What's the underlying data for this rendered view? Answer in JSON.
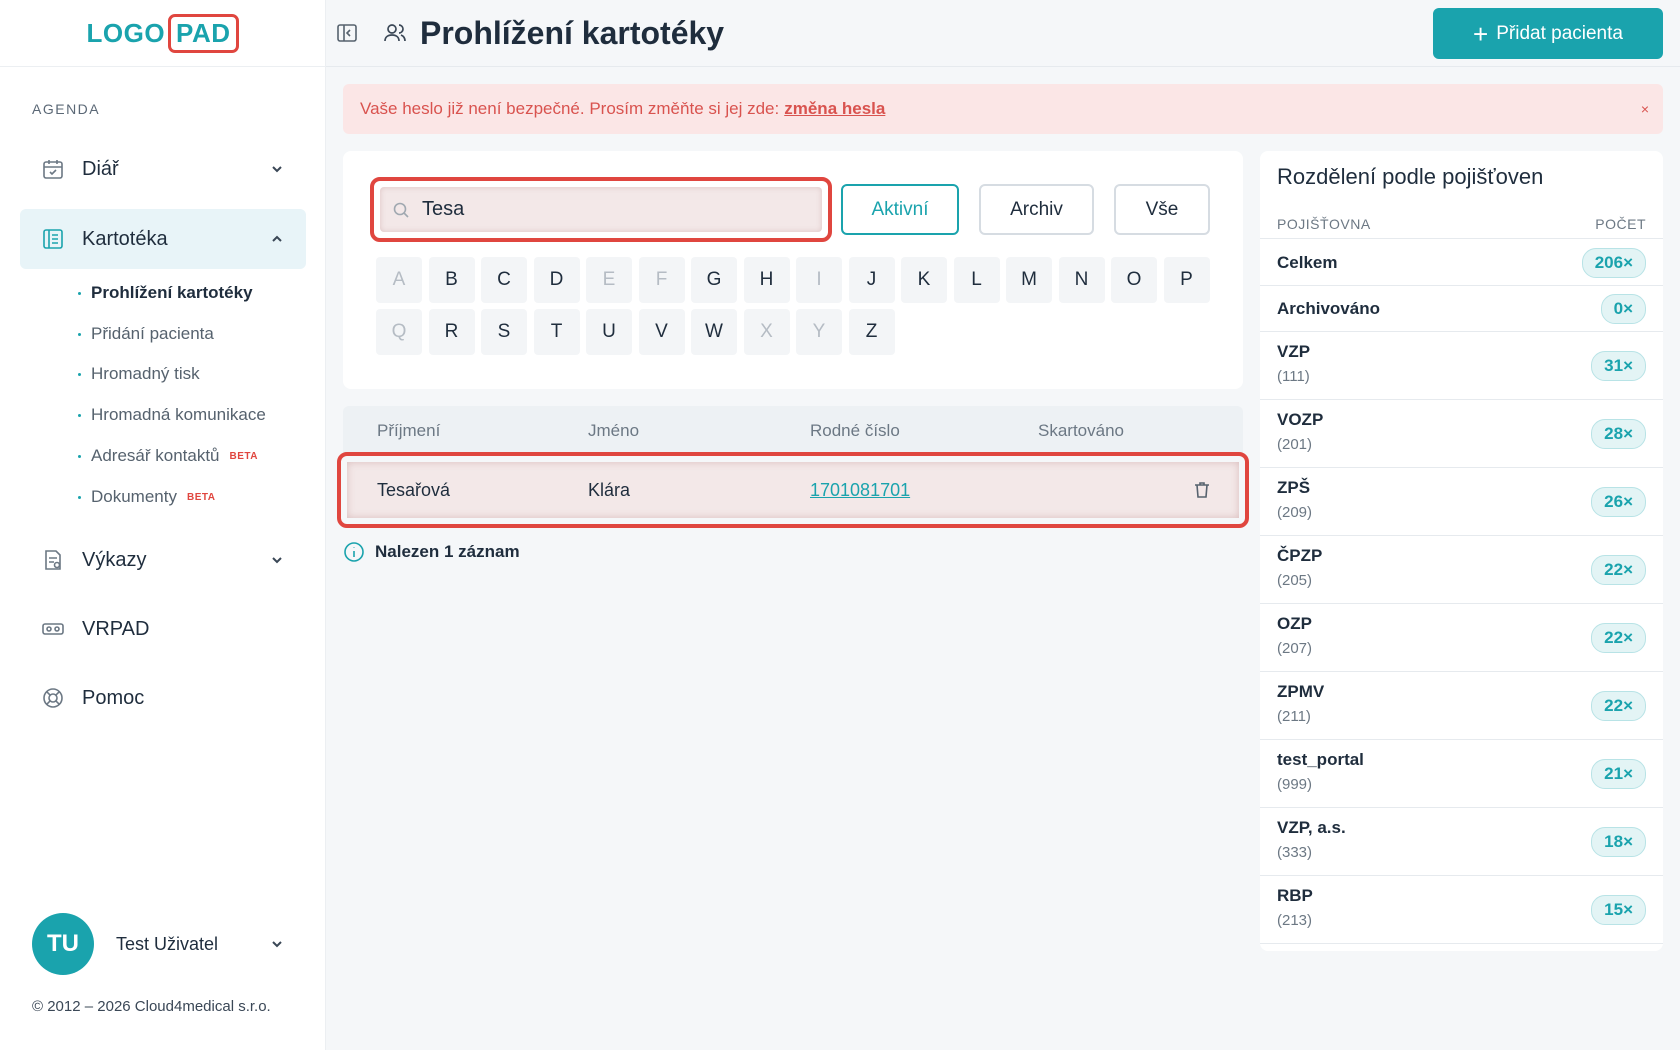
{
  "logo": {
    "part1": "LOGO",
    "part2": "PAD"
  },
  "sidebar": {
    "section": "AGENDA",
    "items": [
      {
        "label": "Diář"
      },
      {
        "label": "Kartotéka"
      },
      {
        "label": "Výkazy"
      },
      {
        "label": "VRPAD"
      },
      {
        "label": "Pomoc"
      }
    ],
    "subitems": [
      {
        "label": "Prohlížení kartotéky"
      },
      {
        "label": "Přidání pacienta"
      },
      {
        "label": "Hromadný tisk"
      },
      {
        "label": "Hromadná komunikace"
      },
      {
        "label": "Adresář kontaktů",
        "badge": "BETA"
      },
      {
        "label": "Dokumenty",
        "badge": "BETA"
      }
    ],
    "user": {
      "initials": "TU",
      "name": "Test Uživatel"
    },
    "copyright": "© 2012 – 2026 Cloud4medical s.r.o."
  },
  "header": {
    "title": "Prohlížení kartotéky",
    "add_button": "Přidat pacienta"
  },
  "alert": {
    "text": "Vaše heslo již není bezpečné. Prosím změňte si jej zde:",
    "link": "změna hesla",
    "close": "×"
  },
  "search": {
    "value": "Tesa",
    "filters": [
      "Aktivní",
      "Archiv",
      "Vše"
    ],
    "active_filter": "Aktivní"
  },
  "letters": [
    {
      "l": "A",
      "enabled": false
    },
    {
      "l": "B",
      "enabled": true
    },
    {
      "l": "C",
      "enabled": true
    },
    {
      "l": "D",
      "enabled": true
    },
    {
      "l": "E",
      "enabled": false
    },
    {
      "l": "F",
      "enabled": false
    },
    {
      "l": "G",
      "enabled": true
    },
    {
      "l": "H",
      "enabled": true
    },
    {
      "l": "I",
      "enabled": false
    },
    {
      "l": "J",
      "enabled": true
    },
    {
      "l": "K",
      "enabled": true
    },
    {
      "l": "L",
      "enabled": true
    },
    {
      "l": "M",
      "enabled": true
    },
    {
      "l": "N",
      "enabled": true
    },
    {
      "l": "O",
      "enabled": true
    },
    {
      "l": "P",
      "enabled": true
    },
    {
      "l": "Q",
      "enabled": false
    },
    {
      "l": "R",
      "enabled": true
    },
    {
      "l": "S",
      "enabled": true
    },
    {
      "l": "T",
      "enabled": true
    },
    {
      "l": "U",
      "enabled": true
    },
    {
      "l": "V",
      "enabled": true
    },
    {
      "l": "W",
      "enabled": true
    },
    {
      "l": "X",
      "enabled": false
    },
    {
      "l": "Y",
      "enabled": false
    },
    {
      "l": "Z",
      "enabled": true
    }
  ],
  "table": {
    "headers": [
      "Příjmení",
      "Jméno",
      "Rodné číslo",
      "Skartováno"
    ],
    "rows": [
      {
        "surname": "Tesařová",
        "name": "Klára",
        "birth_number": "1701081701",
        "shredded": ""
      }
    ],
    "found": "Nalezen 1 záznam"
  },
  "insurers": {
    "title": "Rozdělení podle pojišťoven",
    "col1": "POJIŠŤOVNA",
    "col2": "POČET",
    "items": [
      {
        "name": "Celkem",
        "code": "",
        "count": "206×"
      },
      {
        "name": "Archivováno",
        "code": "",
        "count": "0×"
      },
      {
        "name": "VZP",
        "code": "(111)",
        "count": "31×"
      },
      {
        "name": "VOZP",
        "code": "(201)",
        "count": "28×"
      },
      {
        "name": "ZPŠ",
        "code": "(209)",
        "count": "26×"
      },
      {
        "name": "ČPZP",
        "code": "(205)",
        "count": "22×"
      },
      {
        "name": "OZP",
        "code": "(207)",
        "count": "22×"
      },
      {
        "name": "ZPMV",
        "code": "(211)",
        "count": "22×"
      },
      {
        "name": "test_portal",
        "code": "(999)",
        "count": "21×"
      },
      {
        "name": "VZP, a.s.",
        "code": "(333)",
        "count": "18×"
      },
      {
        "name": "RBP",
        "code": "(213)",
        "count": "15×"
      }
    ]
  },
  "colors": {
    "accent": "#1aa3ad",
    "danger": "#e0463f",
    "alert_bg": "#fbe6e6"
  },
  "icons": {
    "diar": "calendar-icon",
    "kartoteka": "book-icon",
    "vykazy": "report-icon",
    "vrpad": "vr-headset-icon",
    "pomoc": "lifebuoy-icon"
  }
}
